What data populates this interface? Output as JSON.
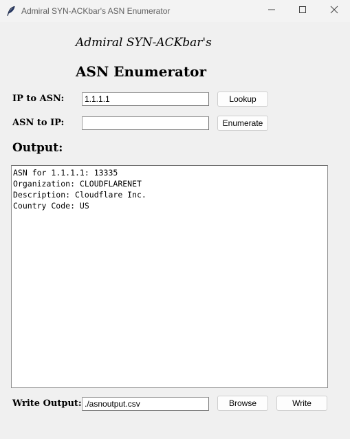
{
  "window": {
    "title": "Admiral SYN-ACKbar's ASN Enumerator"
  },
  "header": {
    "subtitle": "Admiral SYN-ACKbar's",
    "title": "ASN Enumerator"
  },
  "ip_to_asn": {
    "label": "IP to ASN:",
    "value": "1.1.1.1",
    "button": "Lookup"
  },
  "asn_to_ip": {
    "label": "ASN to IP:",
    "value": "",
    "button": "Enumerate"
  },
  "output": {
    "label": "Output:",
    "lines": [
      "ASN for 1.1.1.1: 13335",
      "Organization: CLOUDFLARENET",
      "Description: Cloudflare Inc.",
      "Country Code: US"
    ]
  },
  "write_output": {
    "label": "Write Output:",
    "value": "./asnoutput.csv",
    "browse_button": "Browse",
    "write_button": "Write"
  },
  "icons": {
    "app": "feather-icon",
    "minimize": "minimize-icon",
    "maximize": "maximize-icon",
    "close": "close-icon"
  }
}
